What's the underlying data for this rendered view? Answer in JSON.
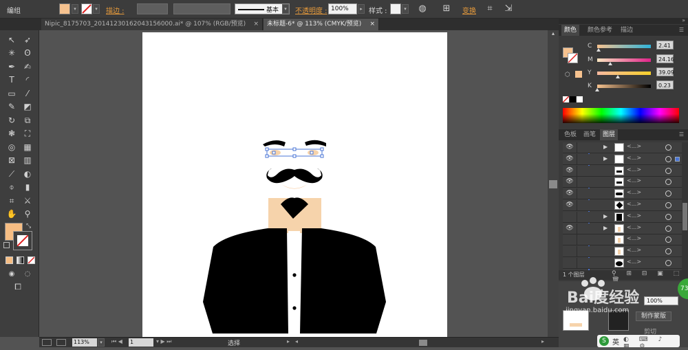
{
  "control_bar": {
    "mode_label": "编组",
    "fill_color": "#f6c28f",
    "stroke_label": "描边 :",
    "stroke_profile": "基本",
    "opacity_label": "不透明度 :",
    "opacity_value": "100%",
    "style_label": "样式 :",
    "transform_label": "变换"
  },
  "tabs": [
    {
      "label": "Nipic_8175703_20141230162043156000.ai* @ 107% (RGB/预览)",
      "close": "×"
    },
    {
      "label": "未标题-6* @ 113% (CMYK/预览)",
      "close": "×"
    }
  ],
  "tools": [
    "select-tool",
    "direct-select-tool",
    "magic-wand-tool",
    "lasso-tool",
    "pen-tool",
    "curvature-tool",
    "type-tool",
    "arc-tool",
    "rectangle-tool",
    "paintbrush-tool",
    "pencil-tool",
    "eraser-tool",
    "rotate-tool",
    "scale-tool",
    "warp-tool",
    "free-transform-tool",
    "shape-builder-tool",
    "perspective-tool",
    "mesh-tool",
    "gradient-tool",
    "eyedropper-tool",
    "blend-tool",
    "symbol-sprayer-tool",
    "column-graph-tool",
    "artboard-tool",
    "slice-tool",
    "hand-tool",
    "zoom-tool"
  ],
  "colors": {
    "skin": "#f6d3ab",
    "fill_swatch": "#f6bd83",
    "accent_orange": "#e69a3b",
    "selection_blue": "#4a74d6"
  },
  "color_panel": {
    "tabs": [
      "颜色",
      "颜色参考",
      "描边"
    ],
    "channels": [
      {
        "name": "C",
        "value": "2.41",
        "fraction": 0.02
      },
      {
        "name": "M",
        "value": "24.16",
        "fraction": 0.24
      },
      {
        "name": "Y",
        "value": "39.09",
        "fraction": 0.39
      },
      {
        "name": "K",
        "value": "0.23",
        "fraction": 0.0
      }
    ]
  },
  "layers_panel": {
    "tabs": [
      "色板",
      "画笔",
      "图层"
    ],
    "layer_count": "1 个图层",
    "row_name": "<...>",
    "rows": [
      {
        "eye": true,
        "arrow": true,
        "thumb": "white",
        "selected_marker": false
      },
      {
        "eye": true,
        "arrow": true,
        "thumb": "white",
        "selected_marker": true
      },
      {
        "eye": true,
        "arrow": false,
        "thumb": "brow",
        "selected_marker": false
      },
      {
        "eye": true,
        "arrow": false,
        "thumb": "brow",
        "selected_marker": false
      },
      {
        "eye": true,
        "arrow": false,
        "thumb": "stripe",
        "selected_marker": false
      },
      {
        "eye": true,
        "arrow": false,
        "thumb": "diamond",
        "selected_marker": false
      },
      {
        "eye": false,
        "arrow": true,
        "thumb": "shirt",
        "selected_marker": false
      },
      {
        "eye": true,
        "arrow": true,
        "thumb": "skin",
        "selected_marker": false
      },
      {
        "eye": false,
        "arrow": false,
        "thumb": "skin",
        "selected_marker": false
      },
      {
        "eye": false,
        "arrow": false,
        "thumb": "skin",
        "selected_marker": false
      },
      {
        "eye": false,
        "arrow": false,
        "thumb": "blob",
        "selected_marker": false
      }
    ]
  },
  "lower_panel": {
    "opacity_value": "100%",
    "make_mask_label": "制作蒙版",
    "clip_label": "剪切"
  },
  "watermark": {
    "text": "Bai度经验",
    "url": "jingyan.baidu.com"
  },
  "ime": {
    "label": "英"
  },
  "status_bar": {
    "zoom": "113%",
    "page": "1",
    "tool_label": "选择"
  }
}
